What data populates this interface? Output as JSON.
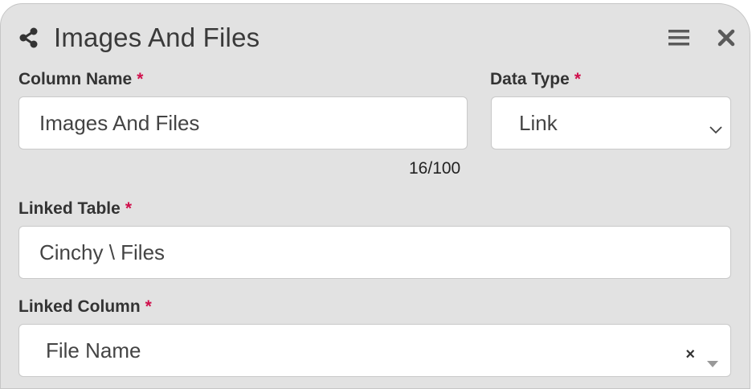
{
  "dialog": {
    "title": "Images And Files"
  },
  "form": {
    "required_marker": "*",
    "column_name": {
      "label": "Column Name",
      "value": "Images And Files",
      "counter": "16/100"
    },
    "data_type": {
      "label": "Data Type",
      "value": "Link"
    },
    "linked_table": {
      "label": "Linked Table",
      "value": "Cinchy \\ Files"
    },
    "linked_column": {
      "label": "Linked Column",
      "value": "File Name",
      "clear": "×"
    }
  },
  "icons": {
    "header_left": "share-icon",
    "menu": "hamburger-menu-icon",
    "close": "close-icon",
    "select_arrow": "chevron-down-icon",
    "dropdown_arrow": "caret-down-icon"
  },
  "colors": {
    "panel_bg": "#e2e2e2",
    "required": "#d0104c",
    "icon": "#5a5a5a"
  }
}
